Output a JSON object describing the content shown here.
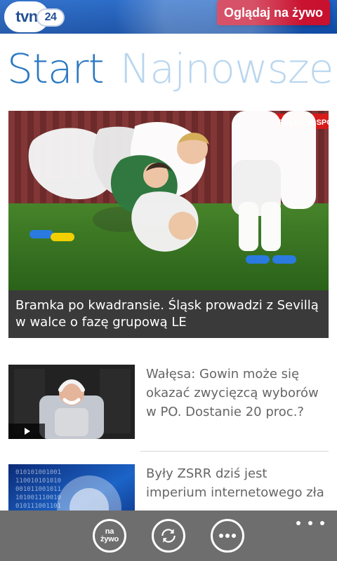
{
  "header": {
    "logo": {
      "main": "tvn",
      "suffix": "24"
    },
    "live_button_label": "Oglądaj na żywo",
    "colors": {
      "blue": "#1e63c5",
      "red": "#c8102e"
    }
  },
  "pivot": {
    "items": [
      "Start",
      "Najnowsze Po"
    ]
  },
  "hero": {
    "badge": "RELACJA SPO",
    "caption": "Bramka po kwadransie. Śląsk prowadzi z Sevillą w walce o fazę grupową LE"
  },
  "news": [
    {
      "title": "Wałęsa: Gowin może się okazać zwycięzcą wyborów w PO. Dostanie 20 proc.?"
    },
    {
      "title": "Były ZSRR dziś jest imperium internetowego zła"
    }
  ],
  "appbar": {
    "live_short": "na\nżywo",
    "icons": [
      "refresh-icon",
      "more-icon"
    ]
  }
}
